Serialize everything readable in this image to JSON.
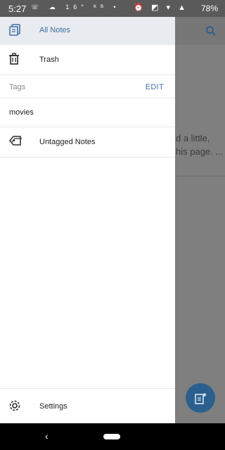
{
  "status_bar": {
    "time": "5:27",
    "left_icons": "☏ ☁ 16° ᴷᴮ •",
    "right_icons": "⏰ ◩ ▾ ▲",
    "battery": "78%"
  },
  "background": {
    "text_line1": "d a little,",
    "text_line2": "his page. ..."
  },
  "drawer": {
    "all_notes": "All Notes",
    "trash": "Trash",
    "tags_header": "Tags",
    "edit": "EDIT",
    "tag_items": [
      "movies"
    ],
    "untagged": "Untagged Notes",
    "settings": "Settings"
  },
  "colors": {
    "accent": "#3f6fa4",
    "drawer_bg": "#ffffff",
    "header_bg": "#e8ebef"
  }
}
